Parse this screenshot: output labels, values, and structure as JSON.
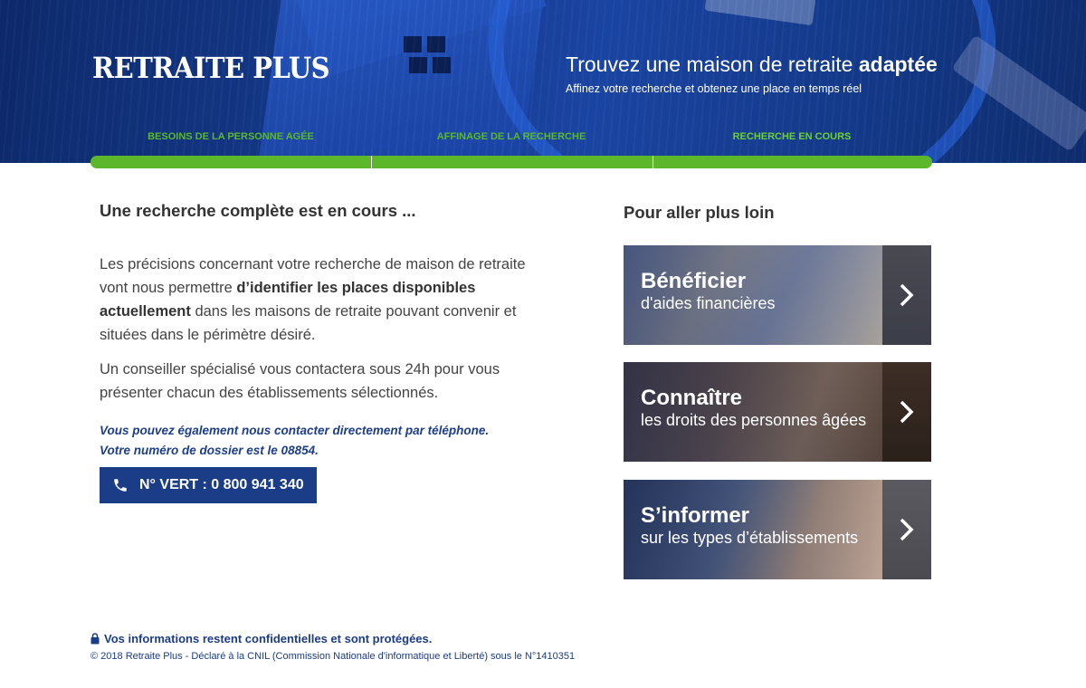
{
  "header": {
    "logo": "RETRAITE PLUS",
    "tagline_main": "Trouvez une maison de retraite",
    "tagline_emphasis": "adaptée",
    "tagline_sub": "Affinez votre recherche et obtenez une place en temps réel"
  },
  "steps": [
    {
      "label": "Besoins de la personne agée",
      "color": "#5cb82a"
    },
    {
      "label": "Affinage de la recherche",
      "color": "#5cb82a"
    },
    {
      "label": "Recherche en cours",
      "color": "#6cd034"
    }
  ],
  "progress": {
    "fraction": 1.0,
    "color": "#5cb82a"
  },
  "main": {
    "title": "Une recherche complète est en cours ...",
    "para1_a": "Les précisions concernant votre recherche de maison de retraite vont nous permettre ",
    "para1_bold": "d’identifier les places disponibles actuellement",
    "para1_b": " dans les maisons de retraite pouvant convenir et situées dans le périmètre désiré.",
    "para2": "Un conseiller spécialisé vous contactera sous 24h pour vous présenter chacun des établissements sélectionnés.",
    "note_line1": "Vous pouvez également nous contacter directement par téléphone.",
    "note_line2": "Votre numéro de dossier est le 08854.",
    "phone_button": "N° VERT : 0 800 941 340"
  },
  "sidebar": {
    "title": "Pour aller plus loin",
    "cards": [
      {
        "title": "Bénéficier",
        "subtitle": "d'aides financières"
      },
      {
        "title": "Connaître",
        "subtitle": "les droits des personnes âgées"
      },
      {
        "title": "S’informer",
        "subtitle": "sur les types d’établissements"
      }
    ]
  },
  "footer": {
    "secure_text": "Vos informations restent confidentielles et sont protégées.",
    "copyright": "© 2018 Retraite Plus - Déclaré à la CNIL (Commission Nationale d'informatique et Liberté) sous le N°1410351"
  },
  "colors": {
    "brand_blue": "#1b3c86",
    "progress_green": "#5cb82a"
  },
  "icons": {
    "phone": "phone-icon",
    "lock": "lock-icon",
    "card_arrow": "chevron-right-icon"
  }
}
